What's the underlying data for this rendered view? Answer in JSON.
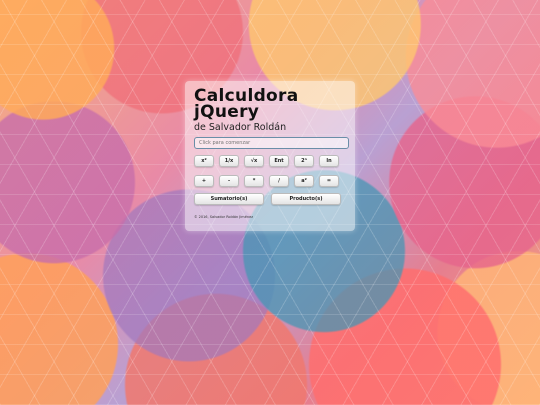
{
  "app": {
    "title_line1": "Calculdora",
    "title_line2": "jQuery",
    "subtitle": "de Salvador Roldán"
  },
  "display": {
    "placeholder": "Click para comenzar",
    "value": ""
  },
  "buttons_row1": [
    "x²",
    "1/x",
    "√x",
    "Ent",
    "2ⁿ",
    "ln"
  ],
  "buttons_row2": [
    "+",
    "-",
    "*",
    "/",
    "a²",
    "="
  ],
  "buttons_row3": [
    "Sumatorio(s)",
    "Producto(s)"
  ],
  "footer": "© 2016, Salvador Roldán Jiménez",
  "colors": {
    "panel": "#ffffff",
    "display_border": "#6a8ea8",
    "title": "#111111"
  }
}
